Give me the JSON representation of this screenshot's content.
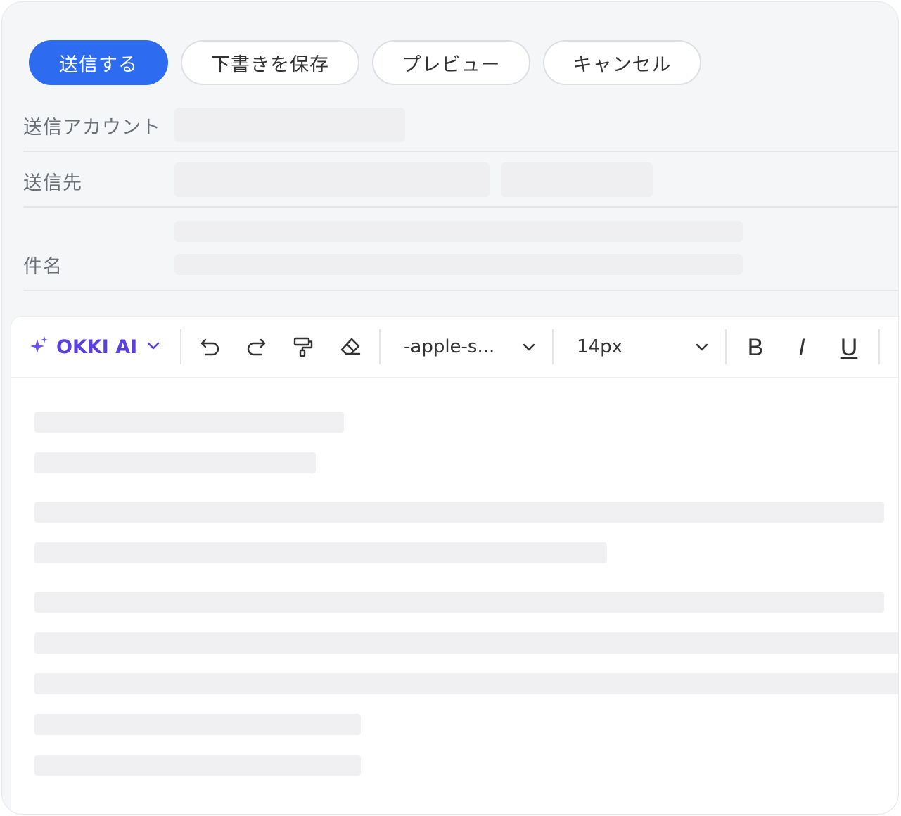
{
  "actions": {
    "send": "送信する",
    "save_draft": "下書きを保存",
    "preview": "プレビュー",
    "cancel": "キャンセル"
  },
  "fields": {
    "account_label": "送信アカウント",
    "to_label": "送信先",
    "subject_label": "件名"
  },
  "toolbar": {
    "ai_label": "OKKI AI",
    "font_family": "-apple-s...",
    "font_size": "14px",
    "icons": [
      "sparkle-icon",
      "chevron-down-icon",
      "undo-icon",
      "redo-icon",
      "format-painter-icon",
      "eraser-icon",
      "bold-icon",
      "italic-icon",
      "underline-icon"
    ],
    "bold_glyph": "B",
    "italic_glyph": "I",
    "underline_glyph": "U"
  },
  "colors": {
    "primary": "#2d6cf0",
    "ai_accent": "#5b3fe0",
    "skeleton": "#efeff1",
    "panel_bg": "#f5f6f8"
  }
}
